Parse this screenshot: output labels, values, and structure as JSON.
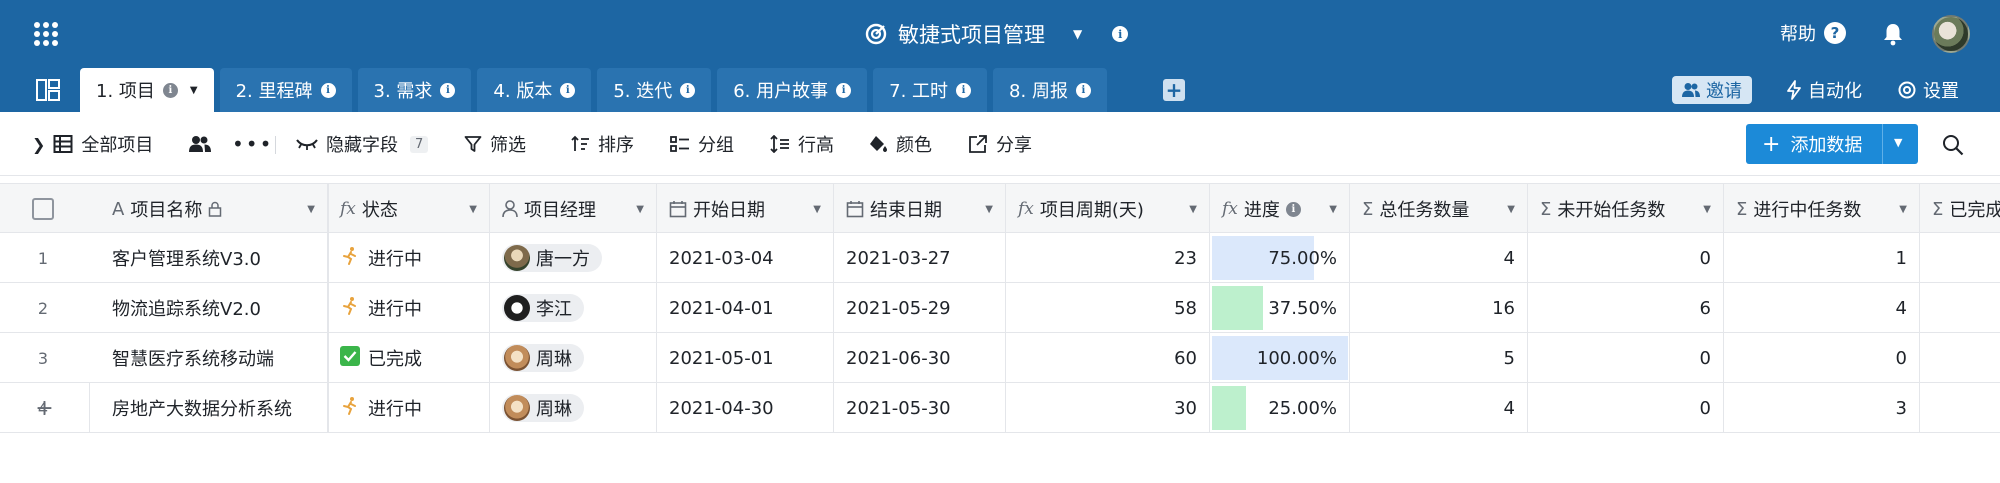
{
  "header": {
    "title": "敏捷式项目管理",
    "help_label": "帮助",
    "help_symbol": "?",
    "info_symbol": "i"
  },
  "tabs": [
    {
      "label": "1. 项目",
      "active": true
    },
    {
      "label": "2. 里程碑"
    },
    {
      "label": "3. 需求"
    },
    {
      "label": "4. 版本"
    },
    {
      "label": "5. 迭代"
    },
    {
      "label": "6. 用户故事"
    },
    {
      "label": "7. 工时"
    },
    {
      "label": "8. 周报"
    }
  ],
  "tabbar_right": {
    "invite_label": "邀请",
    "automation_label": "自动化",
    "settings_label": "设置"
  },
  "toolbar": {
    "view_label": "全部项目",
    "hidden_fields_label": "隐藏字段",
    "hidden_fields_count": "7",
    "filter_label": "筛选",
    "sort_label": "排序",
    "group_label": "分组",
    "row_height_label": "行高",
    "color_label": "颜色",
    "share_label": "分享",
    "add_record_label": "添加数据"
  },
  "columns": [
    "项目名称",
    "状态",
    "项目经理",
    "开始日期",
    "结束日期",
    "项目周期(天)",
    "进度",
    "总任务数量",
    "未开始任务数",
    "进行中任务数",
    "已完成"
  ],
  "rows": [
    {
      "num": "1",
      "name": "客户管理系统V3.0",
      "status": "进行中",
      "status_icon": "running-icon",
      "manager": "唐一方",
      "start": "2021-03-04",
      "end": "2021-03-27",
      "days": "23",
      "progress": 0.75,
      "progress_label": "75.00%",
      "total": "4",
      "not_started": "0",
      "in_progress": "1"
    },
    {
      "num": "2",
      "name": "物流追踪系统V2.0",
      "status": "进行中",
      "status_icon": "running-icon",
      "manager": "李江",
      "start": "2021-04-01",
      "end": "2021-05-29",
      "days": "58",
      "progress": 0.375,
      "progress_label": "37.50%",
      "total": "16",
      "not_started": "6",
      "in_progress": "4"
    },
    {
      "num": "3",
      "name": "智慧医疗系统移动端",
      "status": "已完成",
      "status_icon": "check-icon",
      "manager": "周琳",
      "start": "2021-05-01",
      "end": "2021-06-30",
      "days": "60",
      "progress": 1.0,
      "progress_label": "100.00%",
      "total": "5",
      "not_started": "0",
      "in_progress": "0"
    },
    {
      "num": "4",
      "name": "房地产大数据分析系统",
      "status": "进行中",
      "status_icon": "running-icon",
      "manager": "周琳",
      "start": "2021-04-30",
      "end": "2021-05-30",
      "days": "30",
      "progress": 0.25,
      "progress_label": "25.00%",
      "total": "4",
      "not_started": "0",
      "in_progress": "3"
    }
  ],
  "add_row_symbol": "+",
  "colors": {
    "header_bg": "#1d66a3",
    "add_button": "#1c8ad8",
    "progress_blue": "#dbe8fb",
    "progress_green": "#bdf0cd"
  }
}
